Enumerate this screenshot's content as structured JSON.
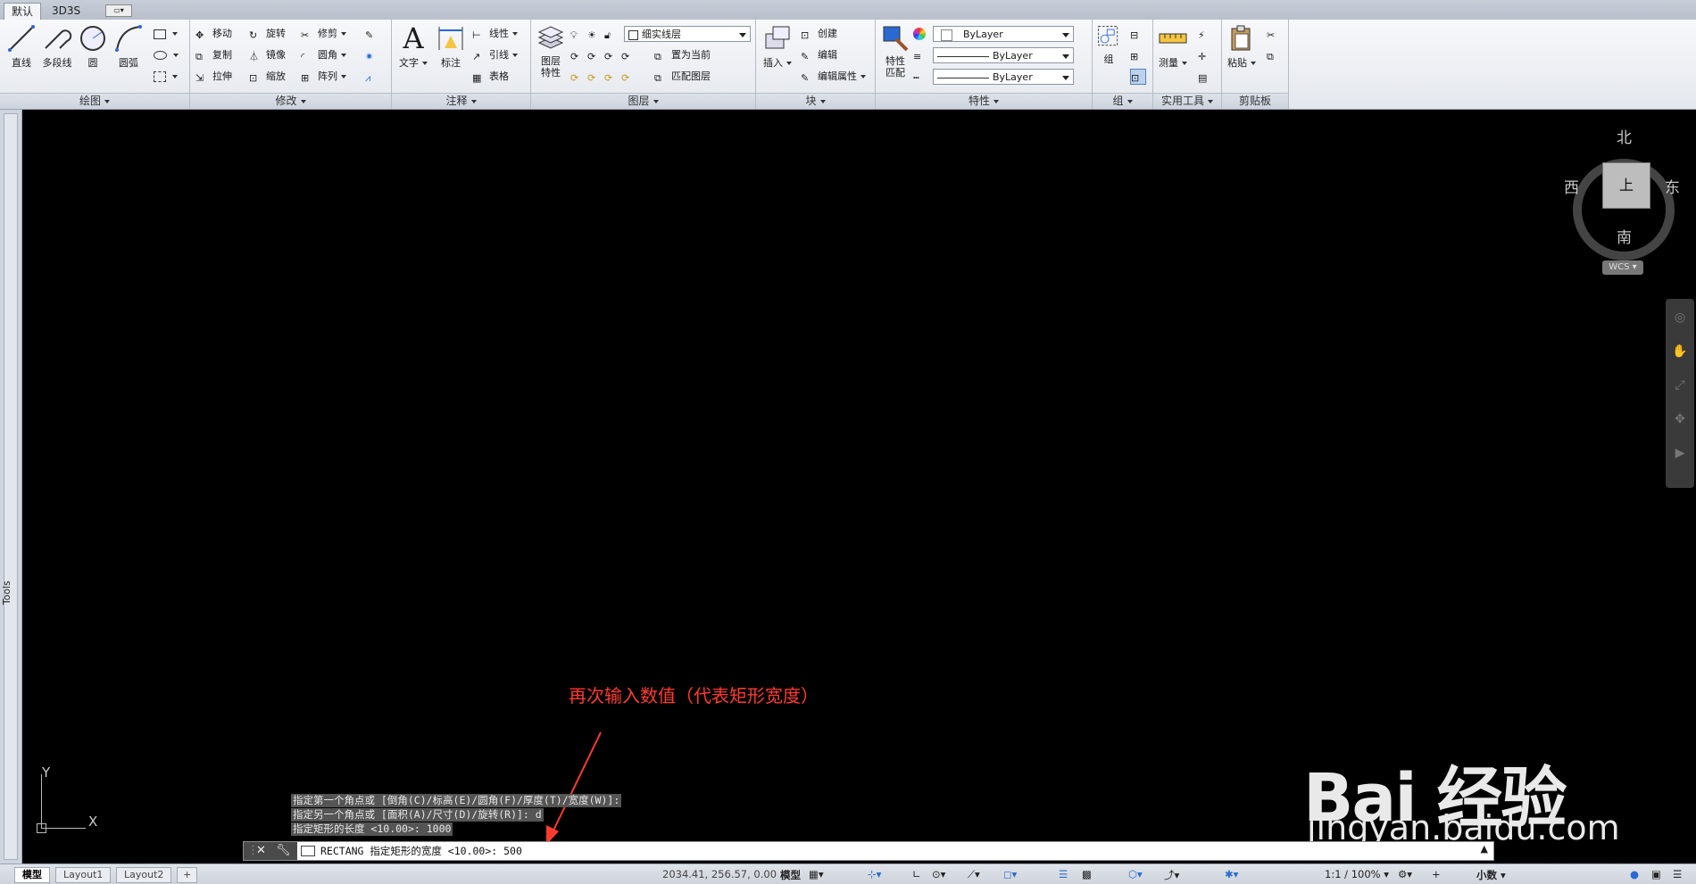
{
  "tabs": [
    "默认",
    "3D3S"
  ],
  "panels": {
    "draw": {
      "title": "绘图",
      "buttons": [
        "直线",
        "多段线",
        "圆",
        "圆弧"
      ]
    },
    "modify": {
      "title": "修改",
      "rows": [
        [
          "移动",
          "旋转",
          "修剪"
        ],
        [
          "复制",
          "镜像",
          "圆角"
        ],
        [
          "拉伸",
          "缩放",
          "阵列"
        ]
      ]
    },
    "annotate": {
      "title": "注释",
      "big": [
        "文字",
        "标注"
      ],
      "small": [
        "线性",
        "引线",
        "表格"
      ]
    },
    "layers": {
      "title": "图层",
      "big": "图层特性",
      "layer_combo": "细实线层",
      "small": [
        "置为当前",
        "匹配图层"
      ]
    },
    "block": {
      "title": "块",
      "big": "插入",
      "small": [
        "创建",
        "编辑",
        "编辑属性"
      ]
    },
    "properties": {
      "title": "特性",
      "big": "特性匹配",
      "combos": [
        "ByLayer",
        "ByLayer",
        "ByLayer"
      ]
    },
    "group": {
      "title": "组",
      "big": "组"
    },
    "utilities": {
      "title": "实用工具",
      "big": "测量"
    },
    "clipboard": {
      "title": "剪贴板",
      "big": "粘贴"
    }
  },
  "left_palette_label": "Tools",
  "viewcube": {
    "north": "北",
    "south": "南",
    "east": "东",
    "west": "西",
    "face": "上",
    "wcs": "WCS"
  },
  "ucs": {
    "x": "X",
    "y": "Y"
  },
  "annotation": "再次输入数值（代表矩形宽度）",
  "annotation_color": "#ff3b2f",
  "command_history": [
    "指定第一个角点或 [倒角(C)/标高(E)/圆角(F)/厚度(T)/宽度(W)]:",
    "指定另一个角点或 [面积(A)/尺寸(D)/旋转(R)]: d",
    "指定矩形的长度 <10.00>: 1000"
  ],
  "command_line": "RECTANG 指定矩形的宽度 <10.00>:  500",
  "watermark": {
    "logo": "Bai 经验",
    "url": "jingyan.baidu.com"
  },
  "status": {
    "layout_tabs": [
      "模型",
      "Layout1",
      "Layout2"
    ],
    "coordinates": "2034.41, 256.57, 0.00",
    "model_label": "模型",
    "scale": "1:1 / 100%",
    "units": "小数"
  },
  "canvas_color": "#000000"
}
